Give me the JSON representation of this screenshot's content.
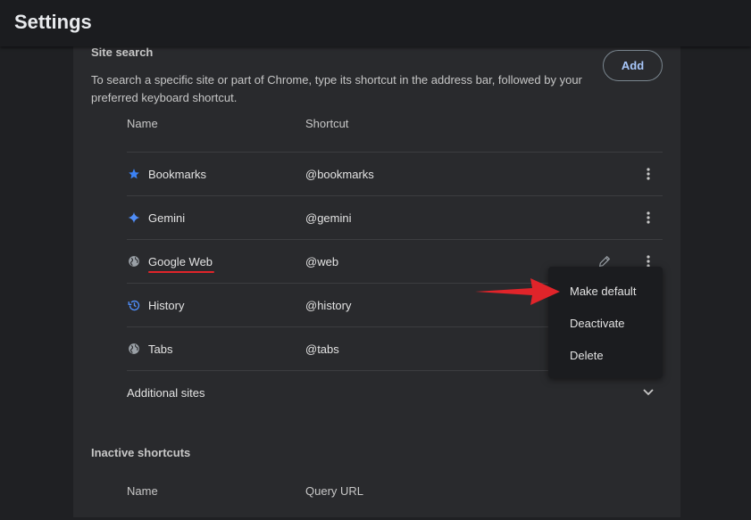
{
  "header": {
    "title": "Settings"
  },
  "site_search": {
    "title": "Site search",
    "description": "To search a specific site or part of Chrome, type its shortcut in the address bar, followed by your preferred keyboard shortcut.",
    "add_label": "Add",
    "columns": {
      "name": "Name",
      "shortcut": "Shortcut"
    },
    "rows": [
      {
        "name": "Bookmarks",
        "shortcut": "@bookmarks",
        "icon": "star-icon"
      },
      {
        "name": "Gemini",
        "shortcut": "@gemini",
        "icon": "sparkle-icon"
      },
      {
        "name": "Google Web",
        "shortcut": "@web",
        "icon": "globe-icon"
      },
      {
        "name": "History",
        "shortcut": "@history",
        "icon": "history-icon"
      },
      {
        "name": "Tabs",
        "shortcut": "@tabs",
        "icon": "globe-icon"
      }
    ],
    "additional_sites": "Additional sites"
  },
  "inactive_shortcuts": {
    "title": "Inactive shortcuts",
    "columns": {
      "name": "Name",
      "query_url": "Query URL"
    }
  },
  "context_menu": {
    "items": [
      "Make default",
      "Deactivate",
      "Delete"
    ]
  },
  "colors": {
    "accent": "#a8c7fa",
    "blue_icon": "#3b82f6",
    "annotation_red": "#e0242a",
    "card_bg": "#292a2d",
    "page_bg": "#1f2023"
  }
}
